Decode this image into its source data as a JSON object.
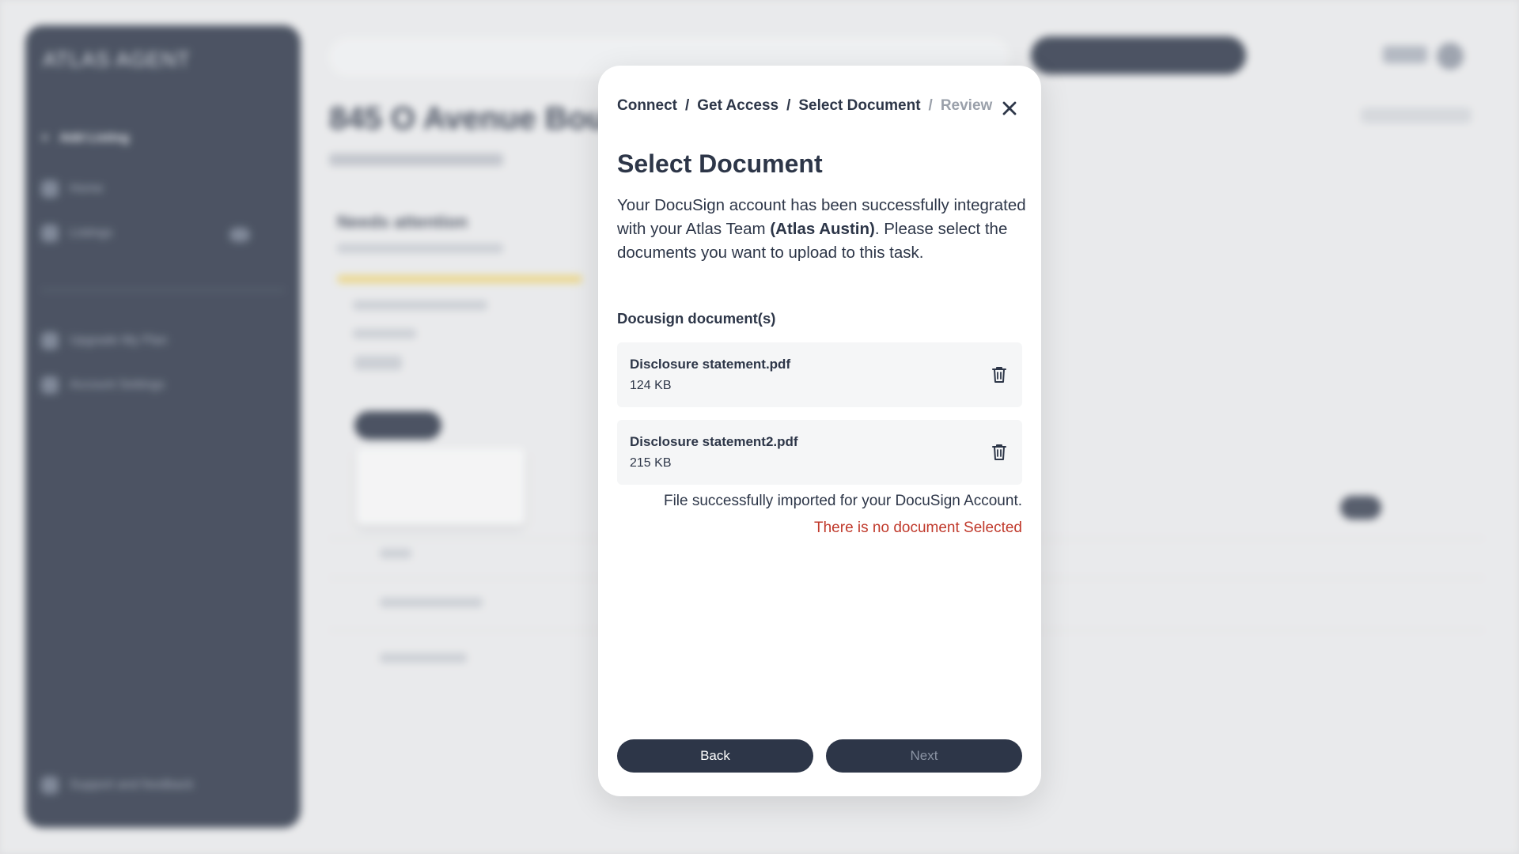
{
  "background": {
    "logo": "ATLAS AGENT",
    "add_listing": "Add Listing",
    "nav": [
      "Home",
      "Listings"
    ],
    "nav_secondary": [
      "Upgrade My Plan",
      "Account Settings"
    ],
    "support": "Support and feedback",
    "page_title": "845 O Avenue Boulder",
    "card_title": "Needs attention"
  },
  "modal": {
    "breadcrumb": {
      "items": [
        "Connect",
        "Get Access",
        "Select Document",
        "Review"
      ],
      "separator": "/"
    },
    "title": "Select Document",
    "description": {
      "line1": "Your DocuSign account has been successfully integrated with your Atlas Team ",
      "team": "(Atlas Austin)",
      "line2": ". Please select the documents you want to upload to this task."
    },
    "section_label": "Docusign document(s)",
    "files": [
      {
        "name": "Disclosure statement.pdf",
        "size": "124 KB"
      },
      {
        "name": "Disclosure statement2.pdf",
        "size": "215 KB"
      }
    ],
    "success_message": "File successfully imported for your DocuSign Account.",
    "error_message": "There is no document Selected",
    "back_label": "Back",
    "next_label": "Next"
  },
  "colors": {
    "primary": "#2d3648",
    "error": "#c0392b",
    "disabled_text": "#9aa0aa"
  }
}
